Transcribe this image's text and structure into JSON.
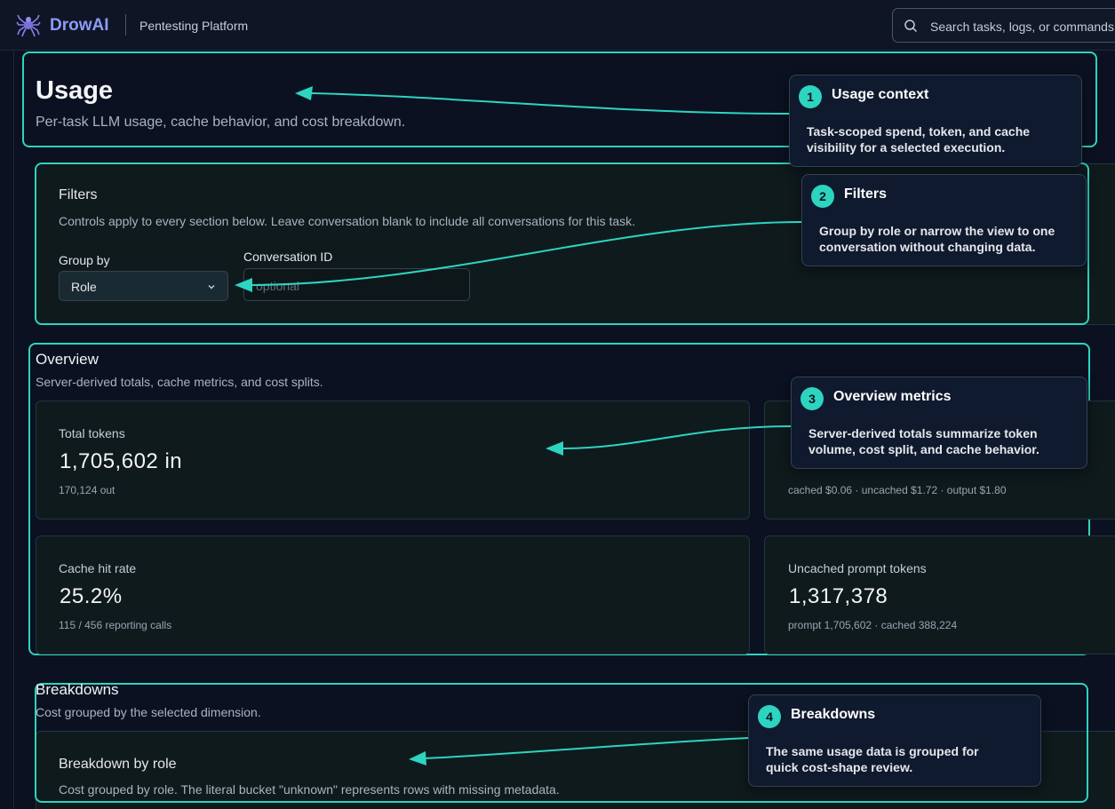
{
  "topbar": {
    "brand": "DrowAI",
    "subtitle": "Pentesting Platform",
    "search_placeholder": "Search tasks, logs, or commands"
  },
  "usage": {
    "title": "Usage",
    "description": "Per-task LLM usage, cache behavior, and cost breakdown."
  },
  "filters": {
    "title": "Filters",
    "description": "Controls apply to every section below. Leave conversation blank to include all conversations for this task.",
    "group_by_label": "Group by",
    "group_by_value": "Role",
    "conversation_label": "Conversation ID",
    "conversation_placeholder": "optional"
  },
  "overview": {
    "title": "Overview",
    "description": "Server-derived totals, cache metrics, and cost splits.",
    "cards": [
      {
        "label": "Total tokens",
        "value": "1,705,602 in",
        "sub": "170,124 out"
      },
      {
        "label": "",
        "value": "",
        "sub": "cached $0.06 · uncached $1.72 · output $1.80"
      },
      {
        "label": "Cache hit rate",
        "value": "25.2%",
        "sub": "115 / 456 reporting calls"
      },
      {
        "label": "Uncached prompt tokens",
        "value": "1,317,378",
        "sub": "prompt 1,705,602 · cached 388,224"
      }
    ]
  },
  "breakdowns": {
    "title": "Breakdowns",
    "description": "Cost grouped by the selected dimension.",
    "panel_title": "Breakdown by role",
    "panel_desc": "Cost grouped by role. The literal bucket \"unknown\" represents rows with missing metadata."
  },
  "callouts": [
    {
      "num": "1",
      "title": "Usage context",
      "body": "Task-scoped spend, token, and cache visibility for a selected execution."
    },
    {
      "num": "2",
      "title": "Filters",
      "body": "Group by role or narrow the view to one conversation without changing data."
    },
    {
      "num": "3",
      "title": "Overview metrics",
      "body": "Server-derived totals summarize token volume, cost split, and cache behavior."
    },
    {
      "num": "4",
      "title": "Breakdowns",
      "body": "The same usage data is grouped for quick cost-shape review."
    }
  ],
  "colors": {
    "accent": "#2dd4bf",
    "brand": "#8b9cf6",
    "background": "#0b1120"
  }
}
